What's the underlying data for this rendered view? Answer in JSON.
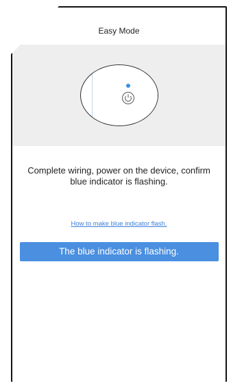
{
  "header": {
    "title": "Easy Mode",
    "back_icon": "chevron-left-icon"
  },
  "illustration": {
    "indicator_color": "#3a8fe0",
    "power_icon": "power-icon"
  },
  "instruction": {
    "text": "Complete wiring, power on the device, confirm blue indicator is flashing."
  },
  "help_link": {
    "label": "How to make blue indicator flash."
  },
  "confirm_button": {
    "label": "The blue indicator is flashing.",
    "color": "#4a8fe0"
  }
}
